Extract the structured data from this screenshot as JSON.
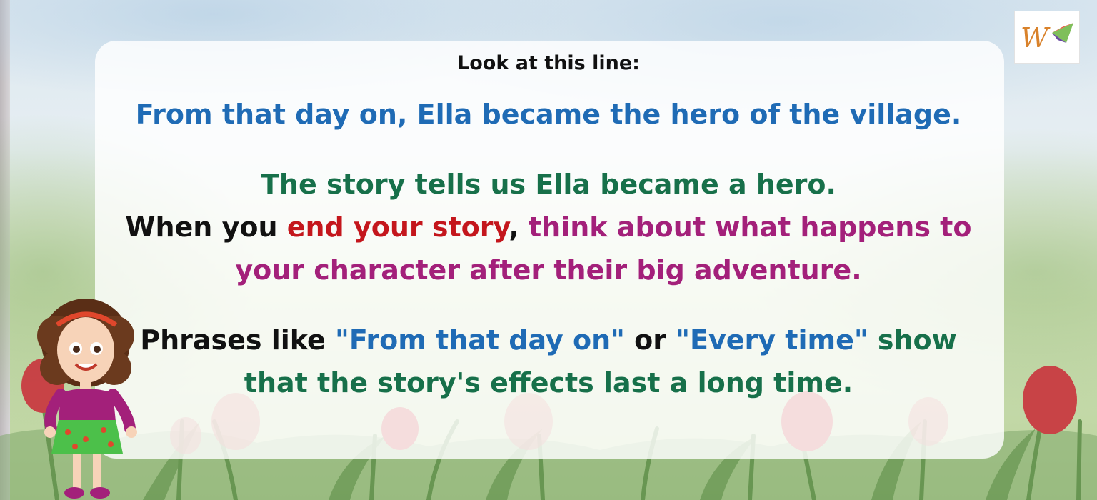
{
  "intro": "Look at this line:",
  "quote": "From that day on, Ella became the hero of the village.",
  "story_line": "The story tells us Ella became a hero.",
  "when": {
    "prefix": "When you ",
    "highlight": "end your story",
    "comma": ", ",
    "rest": "think about what happens to"
  },
  "character_line": "your character after their big adventure.",
  "phrases": {
    "prefix": "Phrases like ",
    "phrase1": "\"From that day on\"",
    "or": " or ",
    "phrase2": "\"Every time\"",
    "show": " show"
  },
  "effects_line": "that the story's effects last a long time.",
  "colors": {
    "blue": "#1f6bb5",
    "green": "#17704a",
    "red": "#c4161c",
    "magenta": "#a3207a",
    "black": "#111111"
  },
  "icons": [
    "logo-icon",
    "girl-illustration",
    "tulip-illustration"
  ]
}
